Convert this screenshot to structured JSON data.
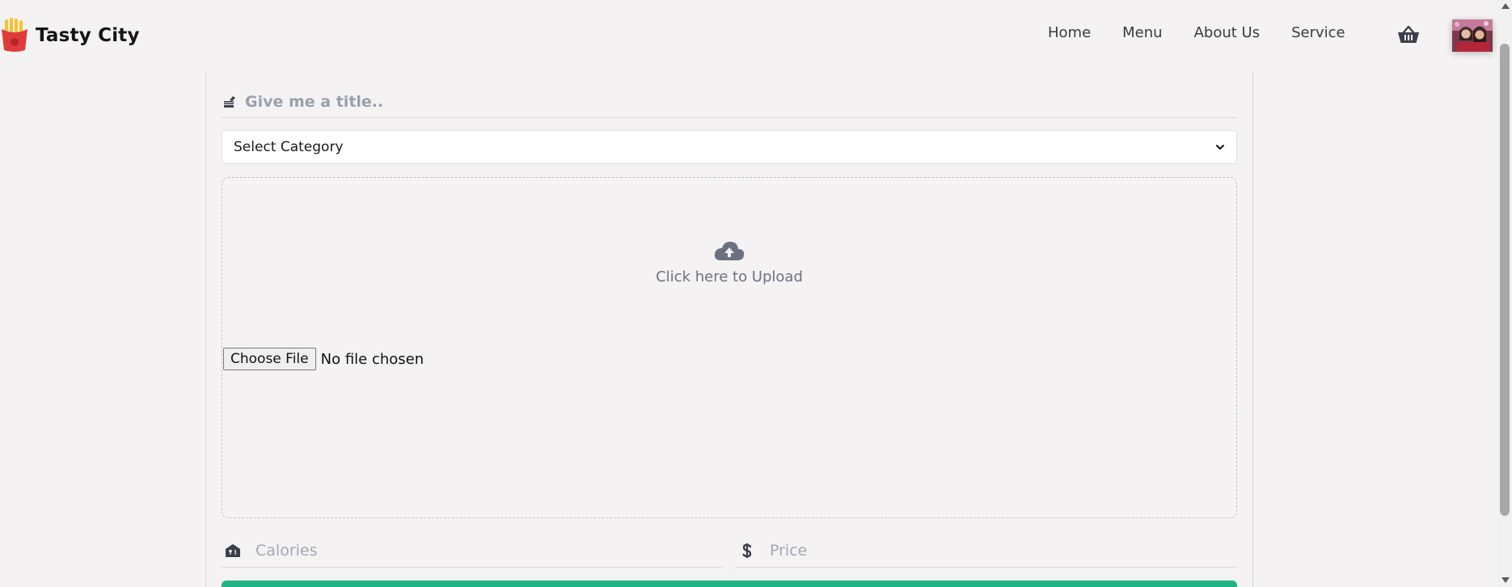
{
  "header": {
    "brand": "Tasty City",
    "nav": [
      {
        "label": "Home"
      },
      {
        "label": "Menu"
      },
      {
        "label": "About Us"
      },
      {
        "label": "Service"
      }
    ],
    "icons": {
      "logo": "fries-box-icon",
      "cart": "shopping-basket-icon",
      "avatar": "user-avatar"
    }
  },
  "form": {
    "title_placeholder": "Give me a title..",
    "category_selected": "Select Category",
    "upload_text": "Click here to Upload",
    "file_button": "Choose File",
    "file_status": "No file chosen",
    "calories_placeholder": "Calories",
    "price_placeholder": "Price"
  },
  "colors": {
    "background": "#f4f2f3",
    "accent": "#21b383",
    "brand_red": "#e03a3a",
    "placeholder": "#9aa0ad"
  }
}
